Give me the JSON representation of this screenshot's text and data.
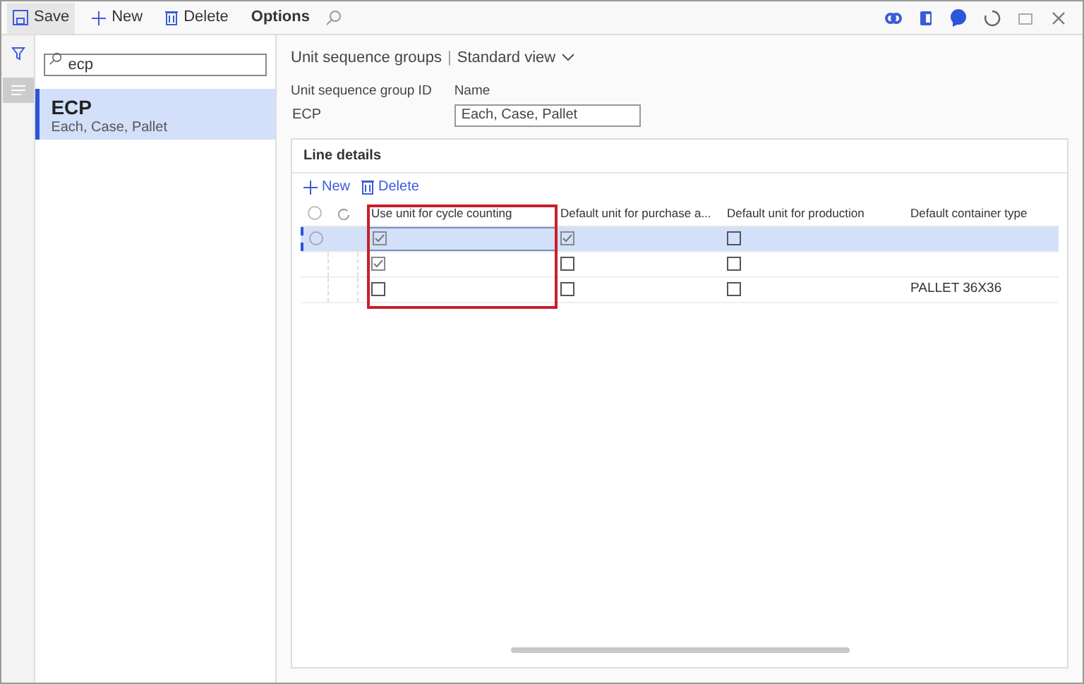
{
  "toolbar": {
    "buttons": [
      {
        "kind": "save",
        "label": "Save"
      },
      {
        "kind": "new",
        "label": "New"
      },
      {
        "kind": "delete",
        "label": "Delete"
      },
      {
        "kind": "text",
        "label": "Options"
      },
      {
        "kind": "search"
      }
    ]
  },
  "list_panel": {
    "search": {
      "value": "ecp"
    },
    "items": [
      {
        "title": "ECP",
        "subtitle": "Each, Case, Pallet",
        "selected": true
      }
    ]
  },
  "header": {
    "breadcrumb": "Unit sequence groups",
    "separator": "|",
    "view": "Standard view"
  },
  "fields": [
    {
      "label": "Unit sequence group ID",
      "value": "ECP",
      "kind": "text"
    },
    {
      "label": "Name",
      "value": "Each, Case, Pallet",
      "kind": "input"
    }
  ],
  "line_details": {
    "title": "Line details",
    "actions": [
      {
        "kind": "new",
        "label": "New"
      },
      {
        "kind": "delete",
        "label": "Delete"
      }
    ],
    "columns": [
      "Use unit for cycle counting",
      "Default unit for purchase a...",
      "Default unit for production",
      "Default container type"
    ],
    "rows": [
      {
        "selected": true,
        "cycle_counting": true,
        "purchase": true,
        "production": false,
        "container": ""
      },
      {
        "selected": false,
        "cycle_counting": true,
        "purchase": false,
        "production": false,
        "container": ""
      },
      {
        "selected": false,
        "cycle_counting": false,
        "purchase": false,
        "production": false,
        "container": "PALLET 36X36"
      }
    ]
  }
}
